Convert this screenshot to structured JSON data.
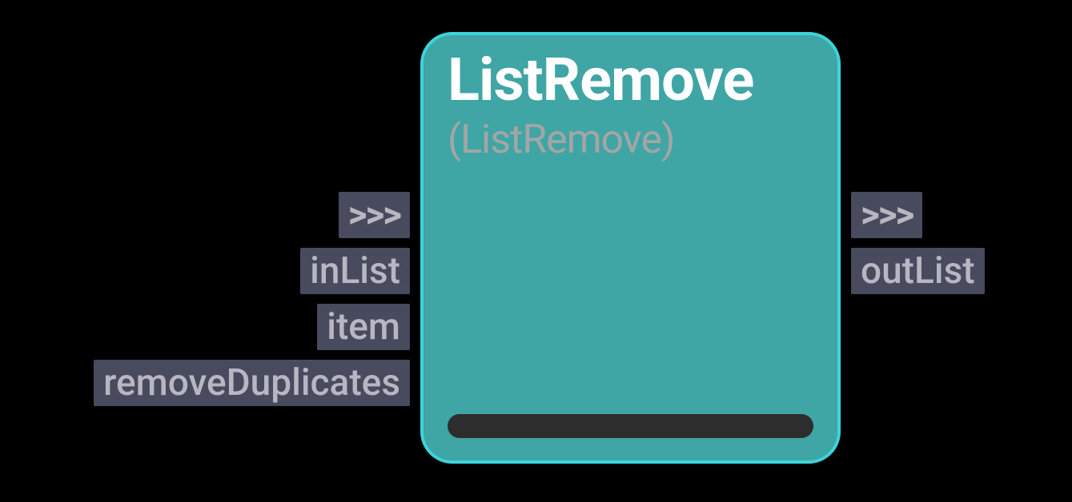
{
  "node": {
    "title": "ListRemove",
    "subtitle": "(ListRemove)",
    "inputs": {
      "exec": ">>>",
      "port1": "inList",
      "port2": "item",
      "port3": "removeDuplicates"
    },
    "outputs": {
      "exec": ">>>",
      "port1": "outList"
    }
  }
}
